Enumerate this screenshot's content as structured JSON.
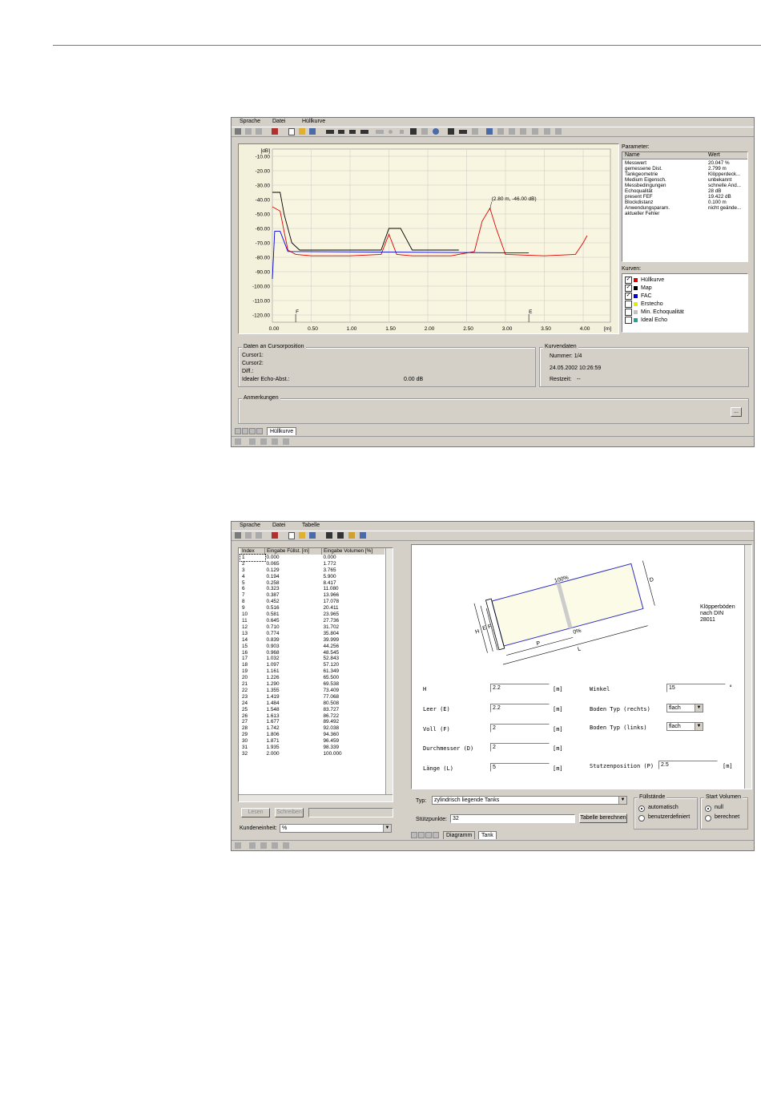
{
  "window1": {
    "menu": [
      "Sprache",
      "Datei",
      "Hüllkurve"
    ],
    "chart": {
      "y_unit": "[dB]",
      "y_ticks": [
        "-10.00",
        "-20.00",
        "-30.00",
        "-40.00",
        "-50.00",
        "-60.00",
        "-70.00",
        "-80.00",
        "-90.00",
        "-100.00",
        "-110.00",
        "-120.00"
      ],
      "x_ticks": [
        "0.00",
        "0.50",
        "1.00",
        "1.50",
        "2.00",
        "2.50",
        "3.00",
        "3.50",
        "4.00"
      ],
      "x_unit": "[m]",
      "annotation": "(2.80 m, -46.00 dB)",
      "marker_f": "F",
      "marker_e": "E"
    },
    "chart_data": {
      "type": "line",
      "xlim": [
        0,
        4.35
      ],
      "ylim": [
        -125,
        -5
      ],
      "series": [
        {
          "name": "Hüllkurve",
          "color": "#e00000",
          "points": [
            [
              0,
              -45
            ],
            [
              0.1,
              -48
            ],
            [
              0.15,
              -62
            ],
            [
              0.2,
              -75
            ],
            [
              0.3,
              -78
            ],
            [
              0.5,
              -79
            ],
            [
              1.0,
              -79
            ],
            [
              1.4,
              -78
            ],
            [
              1.5,
              -64
            ],
            [
              1.6,
              -78
            ],
            [
              1.8,
              -79
            ],
            [
              2.3,
              -79
            ],
            [
              2.6,
              -76
            ],
            [
              2.7,
              -55
            ],
            [
              2.8,
              -46
            ],
            [
              2.88,
              -60
            ],
            [
              3.0,
              -78
            ],
            [
              3.5,
              -79
            ],
            [
              3.9,
              -78
            ],
            [
              4.0,
              -70
            ],
            [
              4.05,
              -65
            ]
          ]
        },
        {
          "name": "Map",
          "color": "#000000",
          "points": [
            [
              0,
              -35
            ],
            [
              0.1,
              -35
            ],
            [
              0.15,
              -50
            ],
            [
              0.25,
              -70
            ],
            [
              0.35,
              -75
            ],
            [
              1.4,
              -75
            ],
            [
              1.5,
              -60
            ],
            [
              1.65,
              -60
            ],
            [
              1.8,
              -75
            ],
            [
              2.4,
              -75
            ]
          ]
        },
        {
          "name": "FAC",
          "color": "#0000dd",
          "points": [
            [
              0,
              -95
            ],
            [
              0.03,
              -62
            ],
            [
              0.1,
              -62
            ],
            [
              0.2,
              -76
            ],
            [
              3.3,
              -77
            ]
          ]
        }
      ]
    },
    "params": {
      "title": "Parameter:",
      "col_name": "Name",
      "col_value": "Wert",
      "rows": [
        [
          "Messwert",
          "20.047  %"
        ],
        [
          "gemessene Dist.",
          "2.799  m"
        ],
        [
          "Tankgeometrie",
          "Klöpperdeck..."
        ],
        [
          "Medium Eigensch.",
          "unbekannt"
        ],
        [
          "Messbedingungen",
          "schnelle And..."
        ],
        [
          "Echoqualität",
          "28  dB"
        ],
        [
          "present FEF",
          "19.422  dB"
        ],
        [
          "Blockdistanz",
          "0.100  m"
        ],
        [
          "Anwendungsparam.",
          "nicht geände..."
        ],
        [
          "aktueller Fehler",
          ""
        ]
      ]
    },
    "curves": {
      "title": "Kurven:",
      "items": [
        {
          "label": "Hüllkurve",
          "checked": "✓",
          "color": "#e00000"
        },
        {
          "label": "Map",
          "checked": "✓",
          "color": "#000000"
        },
        {
          "label": "FAC",
          "checked": "✓",
          "color": "#0000dd"
        },
        {
          "label": "Erstecho",
          "checked": "",
          "color": "#e8e800"
        },
        {
          "label": "Min. Echoqualität",
          "checked": "",
          "color": "#c0c0c0"
        },
        {
          "label": "Ideal Echo",
          "checked": "",
          "color": "#20a0a0"
        }
      ]
    },
    "cursor": {
      "title": "Daten an Cursorposition",
      "cursor1": "Cursor1:",
      "cursor2": "Cursor2:",
      "diff": "Diff.:",
      "ideal": "Idealer Echo-Abst.:",
      "ideal_value": "0.00 dB"
    },
    "curvedata": {
      "title": "Kurvendaten",
      "nummer": "Nummer:  1/4",
      "datum": "24.05.2002  10:26:59",
      "restzeit": "Restzeit:",
      "restzeit_value": "--"
    },
    "notes": {
      "title": "Anmerkungen",
      "button": "..."
    },
    "tab": "Hüllkurve"
  },
  "window2": {
    "menu": [
      "Sprache",
      "Datei",
      "Tabelle"
    ],
    "table": {
      "headers": [
        "Index",
        "Eingabe Füllst. [m]",
        "Eingabe Volumen [%]"
      ],
      "rows": [
        [
          "1",
          "0.000",
          "0.000"
        ],
        [
          "2",
          "0.065",
          "1.772"
        ],
        [
          "3",
          "0.129",
          "3.765"
        ],
        [
          "4",
          "0.194",
          "5.900"
        ],
        [
          "5",
          "0.258",
          "8.417"
        ],
        [
          "6",
          "0.323",
          "11.080"
        ],
        [
          "7",
          "0.387",
          "13.966"
        ],
        [
          "8",
          "0.452",
          "17.078"
        ],
        [
          "9",
          "0.516",
          "20.411"
        ],
        [
          "10",
          "0.581",
          "23.965"
        ],
        [
          "11",
          "0.645",
          "27.736"
        ],
        [
          "12",
          "0.710",
          "31.702"
        ],
        [
          "13",
          "0.774",
          "35.804"
        ],
        [
          "14",
          "0.839",
          "39.999"
        ],
        [
          "15",
          "0.903",
          "44.256"
        ],
        [
          "16",
          "0.968",
          "48.545"
        ],
        [
          "17",
          "1.032",
          "52.843"
        ],
        [
          "18",
          "1.097",
          "57.120"
        ],
        [
          "19",
          "1.161",
          "61.349"
        ],
        [
          "20",
          "1.226",
          "65.500"
        ],
        [
          "21",
          "1.290",
          "69.538"
        ],
        [
          "22",
          "1.355",
          "73.409"
        ],
        [
          "23",
          "1.419",
          "77.068"
        ],
        [
          "24",
          "1.484",
          "80.508"
        ],
        [
          "25",
          "1.548",
          "83.727"
        ],
        [
          "26",
          "1.613",
          "86.722"
        ],
        [
          "27",
          "1.677",
          "89.492"
        ],
        [
          "28",
          "1.742",
          "92.038"
        ],
        [
          "29",
          "1.806",
          "94.360"
        ],
        [
          "30",
          "1.871",
          "96.459"
        ],
        [
          "31",
          "1.935",
          "98.339"
        ],
        [
          "32",
          "2.000",
          "100.000"
        ]
      ]
    },
    "buttons": {
      "lesen": "Lesen",
      "schreiben": "Schreiben"
    },
    "kundeneinheit": {
      "label": "Kundeneinheit:",
      "value": "%"
    },
    "drawing": {
      "label_100": "100%",
      "label_0": "0%",
      "H": "H",
      "E": "E",
      "F": "F",
      "D": "D",
      "P": "P",
      "L": "L",
      "caption": [
        "Klöpperböden",
        "nach DIN",
        "28011"
      ]
    },
    "form": {
      "h": {
        "label": "H",
        "value": "2.2",
        "unit": "[m]"
      },
      "leer": {
        "label": "Leer (E)",
        "value": "2.2",
        "unit": "[m]"
      },
      "voll": {
        "label": "Voll (F)",
        "value": "2",
        "unit": "[m]"
      },
      "durchmesser": {
        "label": "Durchmesser (D)",
        "value": "2",
        "unit": "[m]"
      },
      "laenge": {
        "label": "Länge (L)",
        "value": "5",
        "unit": "[m]"
      },
      "winkel": {
        "label": "Winkel",
        "value": "15",
        "unit": "°"
      },
      "boden_rechts": {
        "label": "Boden Typ (rechts)",
        "value": "flach"
      },
      "boden_links": {
        "label": "Boden Typ (links)",
        "value": "flach"
      },
      "stutzen": {
        "label": "Stutzenposition (P)",
        "value": "2.5",
        "unit": "[m]"
      }
    },
    "bottom": {
      "typ_label": "Typ:",
      "typ_value": "zylindrisch liegende Tanks",
      "stuetz_label": "Stützpunkte:",
      "stuetz_value": "32",
      "calc_button": "Tabelle berechnen",
      "fuell_title": "Füllstände",
      "fuell_auto": "automatisch",
      "fuell_user": "benutzerdefiniert",
      "start_title": "Start Volumen",
      "start_null": "null",
      "start_calc": "berechnet"
    },
    "tabs": [
      "Diagramm",
      "Tank"
    ]
  }
}
